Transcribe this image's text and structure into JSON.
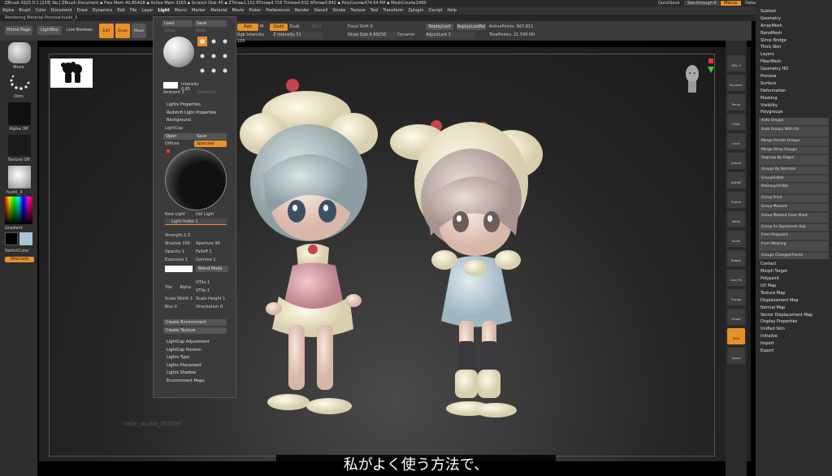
{
  "title_bar": {
    "text": "ZBrush 2025.0.1 [23年 No.]   ZBrush Document      ▪ Free Mem 49.854GB ▪ Active Mem 3263 ▪ Scratch Disk 45 ▪ ZTime▸1.151 RTime▸4.716 Timer▸4.632 ATime▸0.842 ▪ PolyCount▸474.64 MP ▪ MeshCount▸2499",
    "right": [
      "QuickSave",
      "See-through 0",
      "Menus",
      "DefaultZScript"
    ]
  },
  "menu": {
    "items": [
      "Alpha",
      "Brush",
      "Color",
      "Document",
      "Draw",
      "Dynamics",
      "Edit",
      "File",
      "Layer",
      "Light",
      "Macro",
      "Marker",
      "Material",
      "Movie",
      "Picker",
      "Preferences",
      "Render",
      "Stencil",
      "Stroke",
      "Texture",
      "Tool",
      "Transform",
      "Zplugin",
      "Zscript",
      "Help"
    ],
    "active": "Light"
  },
  "rendering_label": "Rendering Material Preview:hushi_3",
  "top_toolbar": {
    "home_page": "Home Page",
    "lightbox": "LightBox",
    "live_boolean": "Live Boolean",
    "tool_buttons": [
      "Edit",
      "Draw",
      "Move",
      "Scale",
      "Rotate"
    ],
    "rgb": "Rgb",
    "m": "M",
    "zadd": "Zadd",
    "zsub": "Zsub",
    "zcut": "Zcut",
    "rgb_intensity": "Rgb Intensity 100",
    "z_intensity": "Z Intensity 51",
    "focal_shift": "Focal Shift 0",
    "draw_size": "Draw Size 4.99256",
    "dynamic": "Dynamic",
    "replay_last": "ReplayLast",
    "replay_last_rel": "ReplayLastRel",
    "adjust_last": "AdjustLast 1",
    "active_points": "ActivePoints: 667,811",
    "total_points": "TotalPoints: 21.599 Mil"
  },
  "left_panel": {
    "brush_label": "Move",
    "stroke_label": "Dots",
    "alpha_label": "Alpha Off",
    "texture_label": "Texture Off",
    "material_label": "hushi_3",
    "gradient": "Gradient",
    "switch_color": "SwitchColor",
    "alternate": "Alternate"
  },
  "light_menu": {
    "load": "Load",
    "save": "Save",
    "undo": "Undo",
    "redo": "Redo",
    "intensity": "Intensity 0.85",
    "ambient": "Ambient 3",
    "distance": "Distance",
    "sections": [
      "Lights Properties",
      "Redshift Light Properties",
      "Background"
    ],
    "lightcap": "LightCap",
    "open": "Open",
    "save2": "Save",
    "diffuse": "Diffuse",
    "specular": "Specular",
    "new_light": "New Light",
    "del_light": "Del Light",
    "light_index": "Light Index 1",
    "strength": "Strength 1.5",
    "shadow": "Shadow 100",
    "aperture": "Aperture 90",
    "opacity": "Opacity 1",
    "falloff": "Falloff 1",
    "exposure": "Exposure 1",
    "gamma": "Gamma 1",
    "blend_mode": "Blend Mode",
    "tile_label": "Tile",
    "alpha_label": "Alpha",
    "htile": "HTile 1",
    "vtile": "VTile 1",
    "scale_width": "Scale Width 1",
    "scale_height": "Scale Height 1",
    "blur": "Blur 0",
    "orientation": "Orientation 0",
    "create_environment": "Create Environment",
    "create_texture": "Create Texture",
    "bottom_sections": [
      "LightCap Adjustment",
      "LightCap Horizon",
      "Lights Type",
      "Lights Placement",
      "Lights Shadow",
      "Environment Maps"
    ]
  },
  "right_shelf": [
    "SPix 3",
    "Dynamic",
    "Persp",
    "Floor",
    "Local",
    "Actual",
    "AAHalf",
    "Frame",
    "Move",
    "Scale",
    "Rotate",
    "Line Fill PolyF",
    "Transp",
    "Ghost",
    "Solo",
    "Xpose"
  ],
  "right_panel": {
    "top_items": [
      "Subtool",
      "Geometry",
      "ArrayMesh",
      "NanoMesh",
      "Slime Bridge",
      "Thick Skin",
      "Layers",
      "FiberMesh",
      "Geometry HD",
      "Preview",
      "Surface",
      "Deformation",
      "Masking",
      "Visibility",
      "Polygroups"
    ],
    "polygroup_rows": [
      "Auto Groups",
      "Auto Groups With UV",
      "Merge Similar Groups",
      "Merge Stray Groups",
      "Regroup By Edges",
      "Groups By Normals",
      "GroupVisible",
      "ReGroupVisible",
      "Group Front",
      "Group Masked",
      "Group Masked Clear Mask",
      "Group As Dynamesh Sub",
      "From Polypaint",
      "From Masking",
      "Groups Changed Points"
    ],
    "bottom_items": [
      "Contact",
      "Morph Target",
      "Polypaint",
      "UV Map",
      "Texture Map",
      "Displacement Map",
      "Normal Map",
      "Vector Displacement Map",
      "Display Properties",
      "Unified Skin",
      "Initialize",
      "Import",
      "Export"
    ]
  },
  "watermark": "Vaila_studio_787895",
  "subtitle": "私がよく使う方法で、",
  "colors": {
    "accent": "#e8912a",
    "panel": "#2d2d2d",
    "menu": "#333333"
  }
}
